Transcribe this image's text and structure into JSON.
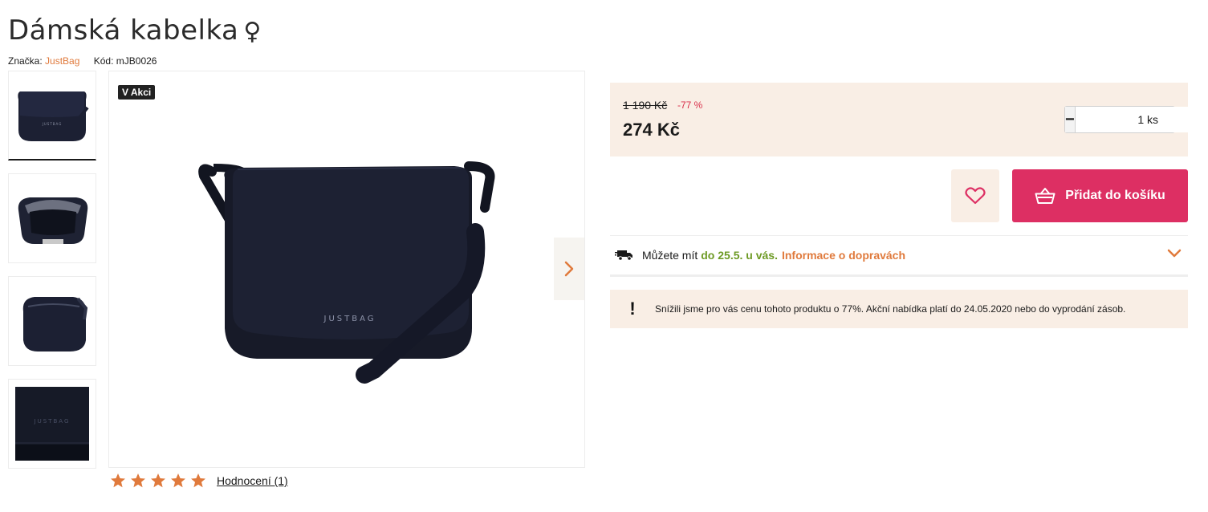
{
  "product": {
    "title": "Dámská kabelka",
    "gender_symbol": "♀",
    "brand_label": "Značka:",
    "brand": "JustBag",
    "code_label": "Kód:",
    "code": "mJB0026"
  },
  "gallery": {
    "badge": "V Akci",
    "bag_logo": "JUSTBAG",
    "thumbnails": [
      "bag-front",
      "bag-open",
      "bag-back",
      "bag-detail"
    ]
  },
  "rating": {
    "stars": 5,
    "max_stars": 5,
    "link_text": "Hodnocení (1)"
  },
  "price": {
    "old": "1 190 Kč",
    "discount": "-77 %",
    "current": "274 Kč"
  },
  "quantity": {
    "minus": "−",
    "value": "1 ks",
    "plus": "+"
  },
  "actions": {
    "wishlist_icon": "heart-icon",
    "add_to_cart": "Přidat do košíku"
  },
  "delivery": {
    "text": "Můžete mít",
    "date": "do 25.5. u vás.",
    "info_link": "Informace o dopravách"
  },
  "notice": {
    "icon": "!",
    "text": "Snížili jsme pro vás cenu tohoto produktu o 77%. Akční nabídka platí do 24.05.2020 nebo do vyprodání zásob."
  },
  "colors": {
    "accent_orange": "#e07a3c",
    "cart_pink": "#dd2f63",
    "price_bg": "#f9eee5",
    "delivery_green": "#6d9a24",
    "discount_red": "#d9304a"
  }
}
